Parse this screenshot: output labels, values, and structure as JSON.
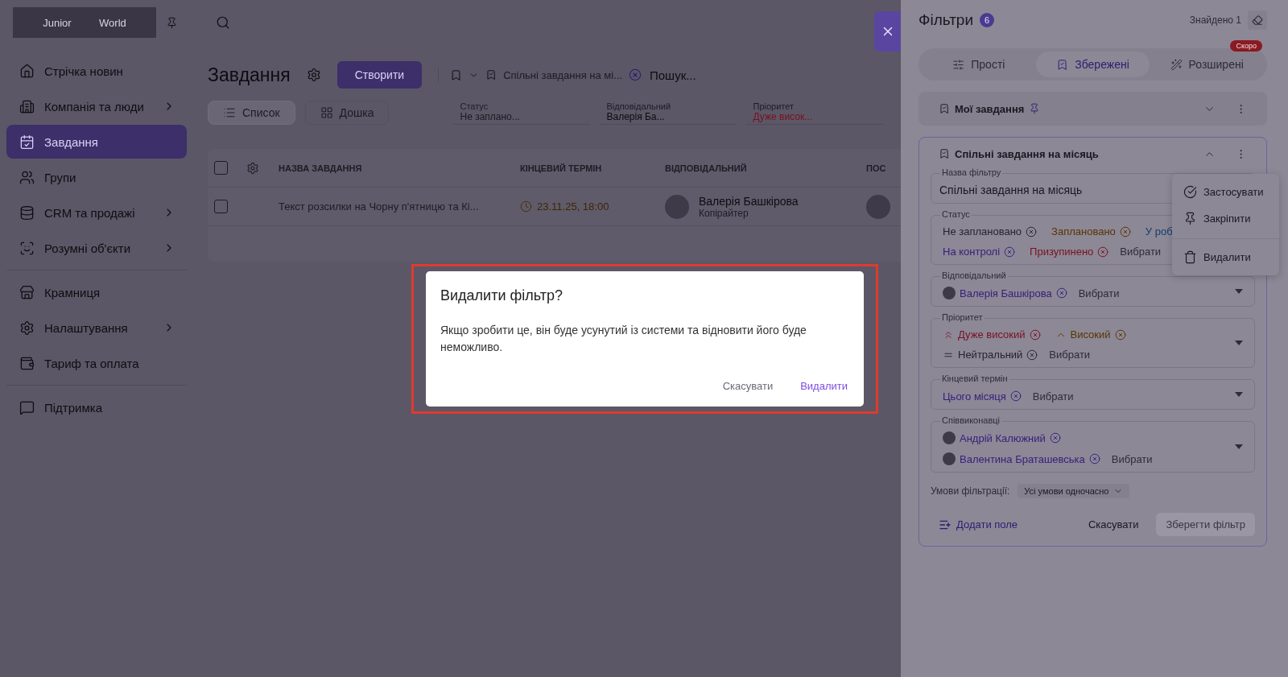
{
  "sidebar": {
    "logo": {
      "left": "Junior",
      "right": "World"
    },
    "groups": [
      [
        {
          "label": "Стрічка новин",
          "selected": false,
          "submenu": false
        },
        {
          "label": "Компанія та люди",
          "selected": false,
          "submenu": true
        },
        {
          "label": "Завдання",
          "selected": true,
          "submenu": false
        },
        {
          "label": "Групи",
          "selected": false,
          "submenu": false
        },
        {
          "label": "CRM та продажі",
          "selected": false,
          "submenu": true
        },
        {
          "label": "Розумні об'єкти",
          "selected": false,
          "submenu": true
        }
      ],
      [
        {
          "label": "Крамниця",
          "selected": false,
          "submenu": false
        },
        {
          "label": "Налаштування",
          "selected": false,
          "submenu": true
        },
        {
          "label": "Тариф та оплата",
          "selected": false,
          "submenu": false
        }
      ],
      [
        {
          "label": "Підтримка",
          "selected": false,
          "submenu": false
        }
      ]
    ]
  },
  "main": {
    "title": "Завдання",
    "create_button": "Створити",
    "saved_filter": "Спільні завдання на мі...",
    "search": {
      "placeholder": "Пошук..."
    },
    "views": [
      {
        "label": "Список",
        "selected": true
      },
      {
        "label": "Дошка",
        "selected": false
      }
    ],
    "quick_filters": [
      {
        "label": "Статус",
        "value": "Не заплано...",
        "color": "#1c1a22"
      },
      {
        "label": "Відповідальний",
        "value": "Валерія Ба...",
        "color": "#0c0b10"
      },
      {
        "label": "Пріоритет",
        "value": "Дуже висок...",
        "color": "#7a1020"
      }
    ],
    "table": {
      "all_checked": false,
      "columns": [
        "НАЗВА ЗАВДАННЯ",
        "КІНЦЕВИЙ ТЕРМІН",
        "ВІДПОВІДАЛЬНИЙ",
        "ПОС"
      ],
      "rows": [
        {
          "checked": false,
          "title": "Текст розсилки на Чорну п'ятницю та Кі...",
          "deadline": "23.11.25, 18:00",
          "assignee": "Валерія Башкірова",
          "role": "Копірайтер"
        }
      ]
    }
  },
  "filters": {
    "title": "Фільтри",
    "count": "6",
    "found": "Знайдено 1",
    "tabs": [
      {
        "label": "Прості",
        "selected": false
      },
      {
        "label": "Збережені",
        "selected": true
      },
      {
        "label": "Розширені",
        "selected": false,
        "badge": "Скоро"
      }
    ],
    "saved": [
      {
        "name": "Мої завдання",
        "pinned": true,
        "expanded": false
      },
      {
        "name": "Спільні завдання на місяць",
        "pinned": false,
        "expanded": true
      }
    ],
    "form": {
      "name_label": "Назва фільтру",
      "name_value": "Спільні завдання на місяць",
      "fields": [
        {
          "label": "Статус",
          "placeholder": "Вибрати",
          "chips": [
            {
              "text": "Не заплановано",
              "kind": "plain",
              "color": "#26242c"
            },
            {
              "text": "Заплановано",
              "kind": "plain",
              "color": "#5a3400"
            },
            {
              "text": "У роб",
              "kind": "plain",
              "color": "#123e6e"
            },
            {
              "text": "На контролі",
              "kind": "plain",
              "color": "#35217a"
            },
            {
              "text": "Призупинено",
              "kind": "plain",
              "color": "#7a1020"
            }
          ]
        },
        {
          "label": "Відповідальний",
          "placeholder": "Вибрати",
          "chips": [
            {
              "text": "Валерія Башкірова",
              "kind": "avatar",
              "color": "#35217a"
            }
          ]
        },
        {
          "label": "Пріоритет",
          "placeholder": "Вибрати",
          "chips": [
            {
              "text": "Дуже високий",
              "kind": "urgent",
              "color": "#7a1020"
            },
            {
              "text": "Високий",
              "kind": "high",
              "color": "#5a3400"
            },
            {
              "text": "Нейтральний",
              "kind": "neutral",
              "color": "#26242c"
            }
          ]
        },
        {
          "label": "Кінцевий термін",
          "placeholder": "Вибрати",
          "chips": [
            {
              "text": "Цього місяця",
              "kind": "plain",
              "color": "#35217a"
            }
          ]
        },
        {
          "label": "Співвиконавці",
          "placeholder": "Вибрати",
          "chips": [
            {
              "text": "Андрій Калюжний",
              "kind": "avatar",
              "color": "#35217a"
            },
            {
              "text": "Валентина Браташевська",
              "kind": "avatar",
              "color": "#35217a"
            }
          ]
        }
      ],
      "conditions_label": "Умови фільтрації:",
      "conditions_value": "Усі умови одночасно",
      "add_field": "Додати поле",
      "cancel": "Скасувати",
      "save": {
        "label": "Зберегти фільтр",
        "disabled": true
      }
    },
    "menu": [
      {
        "label": "Застосувати",
        "kind": "apply"
      },
      {
        "label": "Закріпити",
        "kind": "pin"
      },
      {
        "label": "Видалити",
        "kind": "delete"
      }
    ]
  },
  "dialog": {
    "title": "Видалити фільтр?",
    "text": "Якщо зробити це, він буде усунутий із системи та відновити його буде неможливо.",
    "cancel": "Скасувати",
    "confirm": "Видалити"
  }
}
